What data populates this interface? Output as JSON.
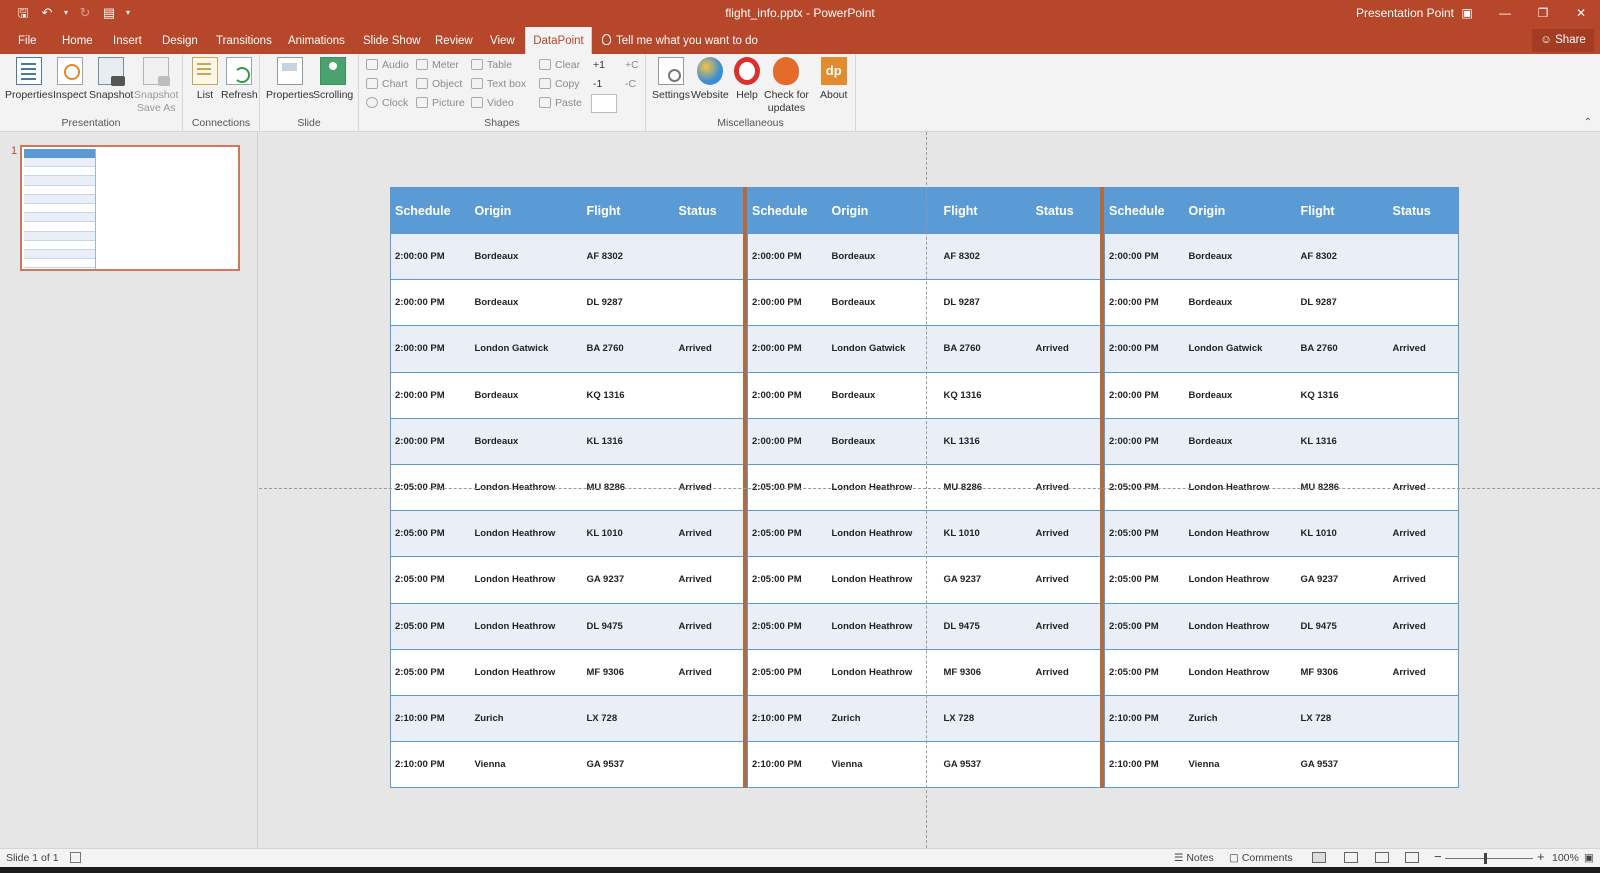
{
  "window": {
    "doc_title": "flight_info.pptx - PowerPoint",
    "account": "Presentation Point",
    "share": "Share"
  },
  "tabs": [
    "File",
    "Home",
    "Insert",
    "Design",
    "Transitions",
    "Animations",
    "Slide Show",
    "Review",
    "View",
    "DataPoint"
  ],
  "active_tab": "DataPoint",
  "tell_me": "Tell me what you want to do",
  "ribbon": {
    "groups": {
      "presentation": "Presentation",
      "connections": "Connections",
      "slide": "Slide",
      "shapes": "Shapes",
      "miscellaneous": "Miscellaneous"
    },
    "presentation": {
      "properties": "Properties",
      "inspect": "Inspect",
      "snapshot": "Snapshot",
      "snapshot_save_as_1": "Snapshot",
      "snapshot_save_as_2": "Save As"
    },
    "connections": {
      "list": "List",
      "refresh": "Refresh"
    },
    "slide": {
      "properties": "Properties",
      "scrolling": "Scrolling"
    },
    "shapes": {
      "audio": "Audio",
      "chart": "Chart",
      "clock": "Clock",
      "meter": "Meter",
      "object": "Object",
      "picture": "Picture",
      "table": "Table",
      "text_box": "Text box",
      "video": "Video",
      "clear": "Clear",
      "copy": "Copy",
      "paste": "Paste",
      "plus_one": "+1",
      "minus_one": "-1",
      "plus_c": "+C",
      "minus_c": "-C"
    },
    "misc": {
      "settings": "Settings",
      "website": "Website",
      "help": "Help",
      "check_updates_1": "Check for",
      "check_updates_2": "updates",
      "about": "About",
      "about_logo": "dp"
    }
  },
  "slide_pane": {
    "slide_number": "1"
  },
  "tables": {
    "headers": [
      "Schedule",
      "Origin",
      "Flight",
      "Status"
    ],
    "rows": [
      [
        "2:00:00 PM",
        "Bordeaux",
        "AF 8302",
        ""
      ],
      [
        "2:00:00 PM",
        "Bordeaux",
        "DL 9287",
        ""
      ],
      [
        "2:00:00 PM",
        "London Gatwick",
        "BA 2760",
        "Arrived"
      ],
      [
        "2:00:00 PM",
        "Bordeaux",
        "KQ 1316",
        ""
      ],
      [
        "2:00:00 PM",
        "Bordeaux",
        "KL 1316",
        ""
      ],
      [
        "2:05:00 PM",
        "London Heathrow",
        "MU 8286",
        "Arrived"
      ],
      [
        "2:05:00 PM",
        "London Heathrow",
        "KL 1010",
        "Arrived"
      ],
      [
        "2:05:00 PM",
        "London Heathrow",
        "GA 9237",
        "Arrived"
      ],
      [
        "2:05:00 PM",
        "London Heathrow",
        "DL 9475",
        "Arrived"
      ],
      [
        "2:05:00 PM",
        "London Heathrow",
        "MF 9306",
        "Arrived"
      ],
      [
        "2:10:00 PM",
        "Zurich",
        "LX 728",
        ""
      ],
      [
        "2:10:00 PM",
        "Vienna",
        "GA 9537",
        ""
      ]
    ]
  },
  "statusbar": {
    "slide_info": "Slide 1 of 1",
    "notes": "Notes",
    "comments": "Comments",
    "zoom": "100%"
  },
  "colors": {
    "ribbon_accent": "#b7472a",
    "table_header": "#5b9bd5",
    "table_alt_row": "#e9eef7",
    "separator": "#b36b3c"
  }
}
